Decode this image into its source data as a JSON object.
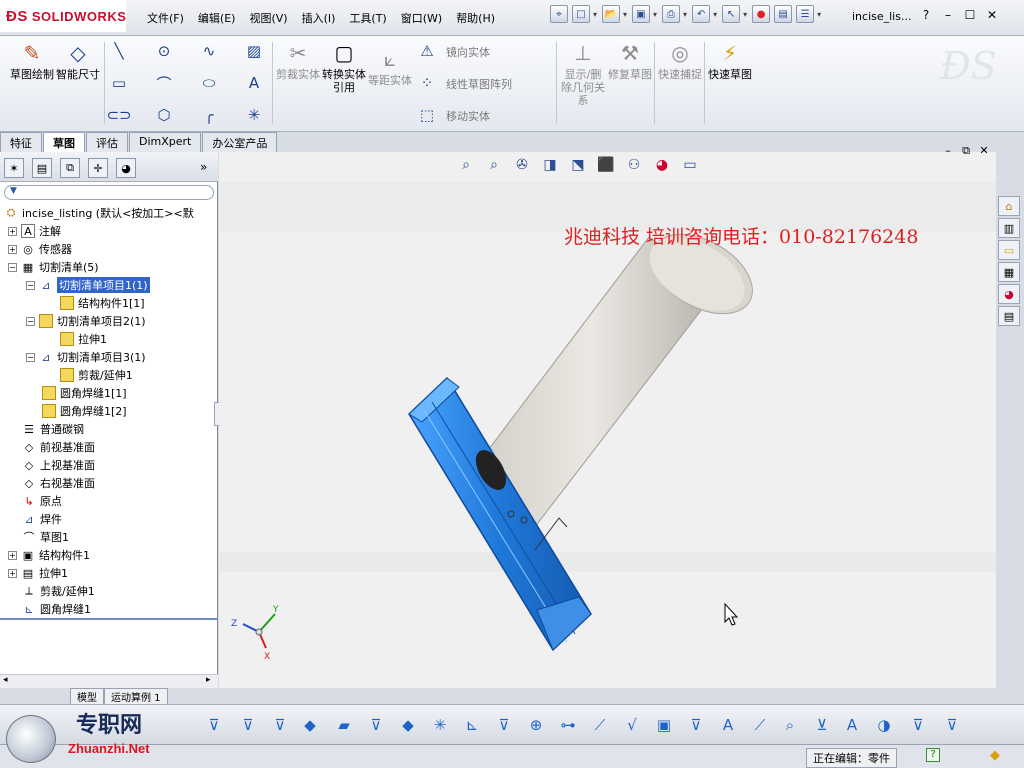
{
  "app": {
    "logo": "SOLIDWORKS",
    "doc_title": "incise_lis..."
  },
  "menu": [
    "文件(F)",
    "编辑(E)",
    "视图(V)",
    "插入(I)",
    "工具(T)",
    "窗口(W)",
    "帮助(H)"
  ],
  "window_controls": [
    "?",
    "–",
    "☐",
    "✕"
  ],
  "command_manager": {
    "sketch_btn": "草图绘制",
    "smart_dim_btn": "智能尺寸",
    "trim_btn": "剪裁实体",
    "convert_btn": "转换实体引用",
    "offset_btn": "等距实体",
    "mirror_btn": "镜向实体",
    "linear_pattern_btn": "线性草图阵列",
    "move_btn": "移动实体",
    "show_relations_btn": "显示/删除几何关系",
    "repair_btn": "修复草图",
    "quick_snap_btn": "快速捕捉",
    "rapid_sketch_btn": "快速草图"
  },
  "tabs": [
    "特征",
    "草图",
    "评估",
    "DimXpert",
    "办公室产品"
  ],
  "active_tab": "草图",
  "tree": {
    "root": "incise_listing  (默认<按加工><默",
    "items": [
      {
        "label": "注解"
      },
      {
        "label": "传感器"
      },
      {
        "label": "切割清单(5)"
      },
      {
        "label": "切割清单项目1(1)"
      },
      {
        "label": "结构构件1[1]"
      },
      {
        "label": "切割清单项目2(1)"
      },
      {
        "label": "拉伸1"
      },
      {
        "label": "切割清单项目3(1)"
      },
      {
        "label": "剪裁/延伸1"
      },
      {
        "label": "圆角焊缝1[1]"
      },
      {
        "label": "圆角焊缝1[2]"
      },
      {
        "label": "普通碳钢"
      },
      {
        "label": "前视基准面"
      },
      {
        "label": "上视基准面"
      },
      {
        "label": "右视基准面"
      },
      {
        "label": "原点"
      },
      {
        "label": "焊件"
      },
      {
        "label": "草图1"
      },
      {
        "label": "结构构件1"
      },
      {
        "label": "拉伸1"
      },
      {
        "label": "剪裁/延伸1"
      },
      {
        "label": "圆角焊缝1"
      }
    ]
  },
  "model_tabs": [
    "模型",
    "运动算例 1"
  ],
  "viewport": {
    "watermark": "兆迪科技    培训咨询电话：010-82176248",
    "axis_labels": {
      "x": "X",
      "y": "Y",
      "z": "Z"
    }
  },
  "status": {
    "editing": "正在编辑：零件",
    "watermark_site_cn": "专职网",
    "watermark_site_en": "Zhuanzhi.Net"
  },
  "colors": {
    "selection": "#2f64c8",
    "watermark": "#e02020",
    "tube": "#2f87e0",
    "part": "#d7d4cf"
  }
}
